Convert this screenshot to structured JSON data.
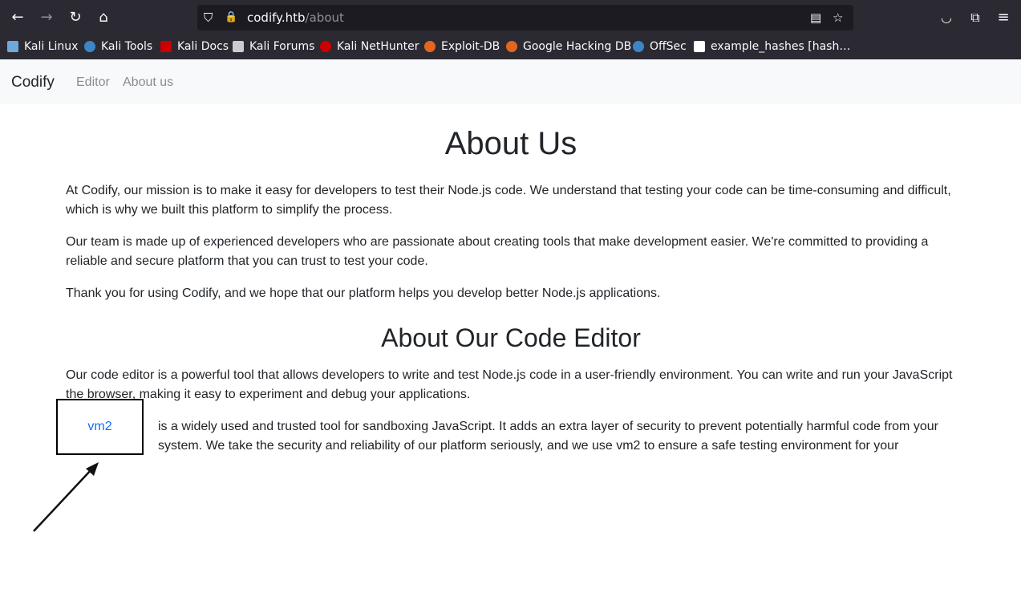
{
  "browser": {
    "url_host": "codify.htb",
    "url_path": "/about",
    "nav_icons": [
      "back-icon",
      "forward-icon",
      "reload-icon",
      "home-icon"
    ],
    "url_icons": [
      "shield-icon",
      "lock-icon",
      "reader-view-icon",
      "bookmark-star-icon"
    ],
    "right_icons": [
      "pocket-icon",
      "extensions-icon",
      "menu-icon"
    ],
    "bookmarks": [
      {
        "label": "Kali Linux",
        "color": "#6fa8dc"
      },
      {
        "label": "Kali Tools",
        "color": "#3d85c6"
      },
      {
        "label": "Kali Docs",
        "color": "#cc0000"
      },
      {
        "label": "Kali Forums",
        "color": "#cccccc"
      },
      {
        "label": "Kali NetHunter",
        "color": "#cc0000"
      },
      {
        "label": "Exploit-DB",
        "color": "#e06621"
      },
      {
        "label": "Google Hacking DB",
        "color": "#e06621"
      },
      {
        "label": "OffSec",
        "color": "#3d85c6"
      },
      {
        "label": "example_hashes [hash…",
        "color": "#ffffff"
      }
    ]
  },
  "navbar": {
    "brand": "Codify",
    "links": [
      "Editor",
      "About us"
    ]
  },
  "main": {
    "heading": "About Us",
    "paragraphs": [
      "At Codify, our mission is to make it easy for developers to test their Node.js code. We understand that testing your code can be time-consuming and difficult, which is why we built this platform to simplify the process.",
      "Our team is made up of experienced developers who are passionate about creating tools that make development easier. We're committed to providing a reliable and secure platform that you can trust to test your code.",
      "Thank you for using Codify, and we hope that our platform helps you develop better Node.js applications."
    ],
    "editor_heading": "About Our Code Editor",
    "editor_paragraphs": [
      "Our code editor is a powerful tool that allows developers to write and test Node.js code in a user-friendly environment. You can write and run your JavaScript the browser, making it easy to experiment and debug your applications.",
      "is a widely used and trusted tool for sandboxing JavaScript. It adds an extra layer of security to prevent potentially harmful code from your system. We take the security and reliability of our platform seriously, and we use vm2 to ensure a safe testing environment for your"
    ],
    "highlight_link": "vm2"
  }
}
